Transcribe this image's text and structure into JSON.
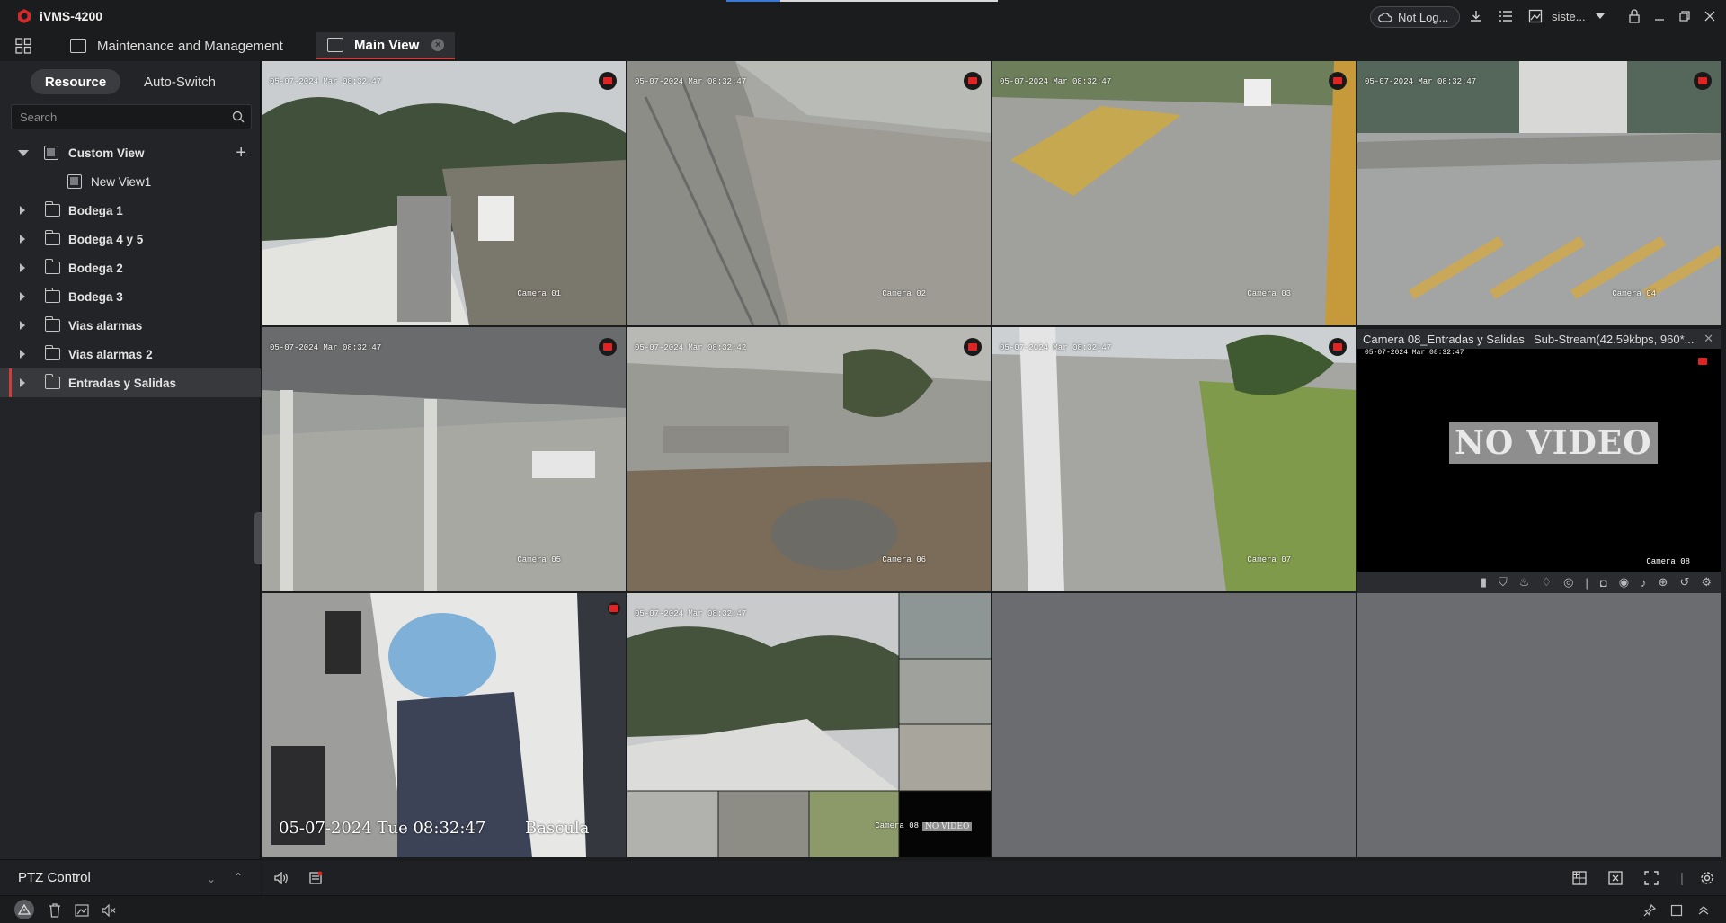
{
  "app": {
    "name": "iVMS-4200"
  },
  "titlebar": {
    "user_status": "Not Log...",
    "username": "siste...",
    "icons": [
      "cloud-icon",
      "download-icon",
      "task-list-icon",
      "image-icon",
      "lock-icon",
      "minimize-icon",
      "restore-icon",
      "close-icon"
    ]
  },
  "tabs": [
    {
      "label": "Maintenance and Management",
      "active": false
    },
    {
      "label": "Main View",
      "active": true
    }
  ],
  "left_panel": {
    "switch": {
      "resource": "Resource",
      "auto_switch": "Auto-Switch"
    },
    "search": {
      "placeholder": "Search"
    },
    "tree": [
      {
        "label": "Custom View",
        "type": "view-group",
        "expanded": true
      },
      {
        "label": "New View1",
        "type": "view",
        "child": true
      },
      {
        "label": "Bodega 1",
        "type": "folder"
      },
      {
        "label": "Bodega 4 y 5",
        "type": "folder"
      },
      {
        "label": "Bodega 2",
        "type": "folder"
      },
      {
        "label": "Bodega 3",
        "type": "folder"
      },
      {
        "label": "Vias alarmas",
        "type": "folder"
      },
      {
        "label": "Vias alarmas 2",
        "type": "folder"
      },
      {
        "label": "Entradas y Salidas",
        "type": "folder",
        "selected": true
      }
    ],
    "ptz": "PTZ Control"
  },
  "cameras": [
    {
      "time": "05-07-2024 Mar 08:32:47",
      "name": "Camera 01"
    },
    {
      "time": "05-07-2024 Mar 08:32:47",
      "name": "Camera 02"
    },
    {
      "time": "05-07-2024 Mar 08:32:47",
      "name": "Camera 03"
    },
    {
      "time": "05-07-2024 Mar 08:32:47",
      "name": "Camera 04"
    },
    {
      "time": "05-07-2024 Mar 08:32:47",
      "name": "Camera 05"
    },
    {
      "time": "05-07-2024 Mar 08:32:42",
      "name": "Camera 06"
    },
    {
      "time": "05-07-2024 Mar 08:32:47",
      "name": "Camera 07"
    }
  ],
  "camera08": {
    "title": "Camera 08_Entradas y Salidas",
    "stream": "Sub-Stream(42.59kbps, 960*...",
    "time": "05-07-2024 Mar 08:32:47",
    "no_video": "NO VIDEO",
    "name": "Camera 08"
  },
  "bascula": {
    "time": "05-07-2024 Tue 08:32:47",
    "name": "Bascula"
  },
  "mosaic": {
    "time": "05-07-2024 Mar 08:32:47",
    "tile_name": "Camera 08",
    "tile_no_video": "NO VIDEO"
  },
  "colors": {
    "accent": "#d33a3a",
    "recording": "#e02424",
    "panel": "#232427",
    "empty_cell": "#6b6c6f"
  }
}
